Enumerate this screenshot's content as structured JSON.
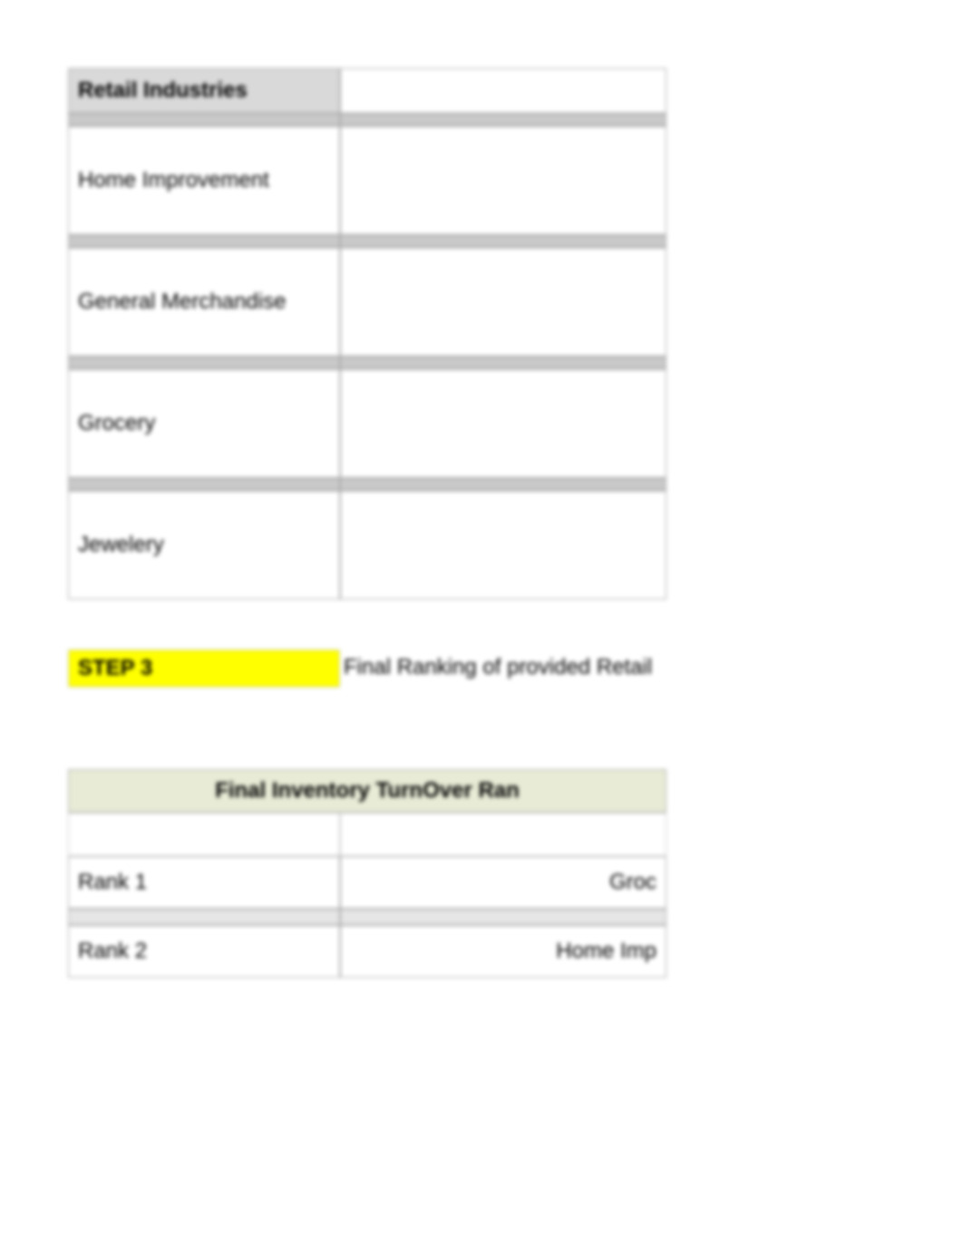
{
  "table1": {
    "header": "Retail Industries",
    "rows": [
      "Home Improvement",
      "General Merchandise",
      "Grocery",
      "Jewelery"
    ]
  },
  "step": {
    "label": "STEP 3",
    "description": "Final Ranking of provided Retail"
  },
  "table2": {
    "header": "Final Inventory TurnOver Ran",
    "rows": [
      {
        "rank": "Rank 1",
        "value": "Groc"
      },
      {
        "rank": "Rank 2",
        "value": "Home Imp"
      }
    ]
  }
}
